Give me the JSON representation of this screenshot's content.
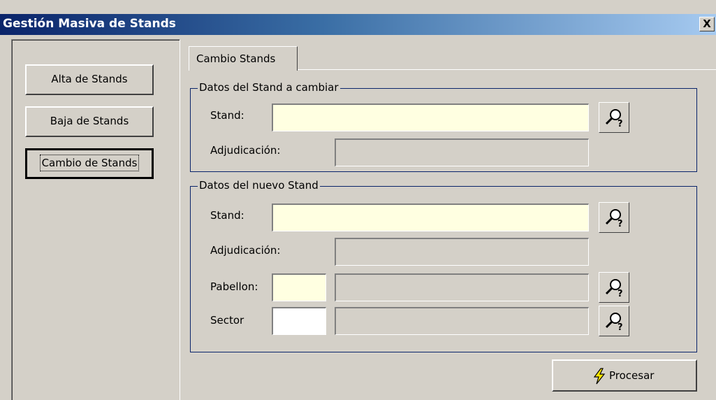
{
  "window": {
    "title": "Gestión Masiva de Stands",
    "close_label": "X"
  },
  "sidebar": {
    "items": [
      {
        "label": "Alta de Stands"
      },
      {
        "label": "Baja de Stands"
      },
      {
        "label": "Cambio de Stands",
        "active": true
      }
    ]
  },
  "tabs": [
    {
      "label": "Cambio Stands",
      "active": true
    }
  ],
  "group_current": {
    "legend": "Datos del Stand a cambiar",
    "stand_label": "Stand:",
    "stand_value": "",
    "adjudicacion_label": "Adjudicación:",
    "adjudicacion_value": ""
  },
  "group_new": {
    "legend": "Datos del nuevo Stand",
    "stand_label": "Stand:",
    "stand_value": "",
    "adjudicacion_label": "Adjudicación:",
    "adjudicacion_value": "",
    "pabellon_label": "Pabellon:",
    "pabellon_code": "",
    "pabellon_desc": "",
    "sector_label": "Sector",
    "sector_code": "",
    "sector_desc": ""
  },
  "actions": {
    "process_label": "Procesar"
  },
  "icons": {
    "search": "magnifier-question-icon",
    "process": "lightning-icon"
  },
  "colors": {
    "title_gradient_start": "#0a246a",
    "title_gradient_end": "#a6caf0",
    "required_field": "#ffffe1",
    "readonly_field": "#d4d0c8",
    "group_border": "#0a246a"
  }
}
